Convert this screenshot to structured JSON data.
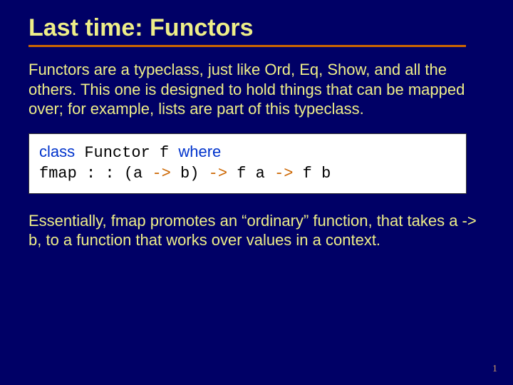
{
  "title": "Last time: Functors",
  "para1": "Functors are a typeclass, just like Ord, Eq, Show, and all the others.  This one is designed to hold things that can be mapped over; for example, lists are part of this typeclass.",
  "code": {
    "kw_class": "class",
    "functor_f": " Functor f ",
    "kw_where": "where",
    "indent": "    fmap : : (a ",
    "arrow1": "->",
    "mid1": " b) ",
    "arrow2": "->",
    "mid2": " f a ",
    "arrow3": "->",
    "mid3": " f b"
  },
  "para2": "Essentially, fmap promotes an “ordinary” function, that takes a -> b, to a function that works over values in a context.",
  "pagenum": "1"
}
